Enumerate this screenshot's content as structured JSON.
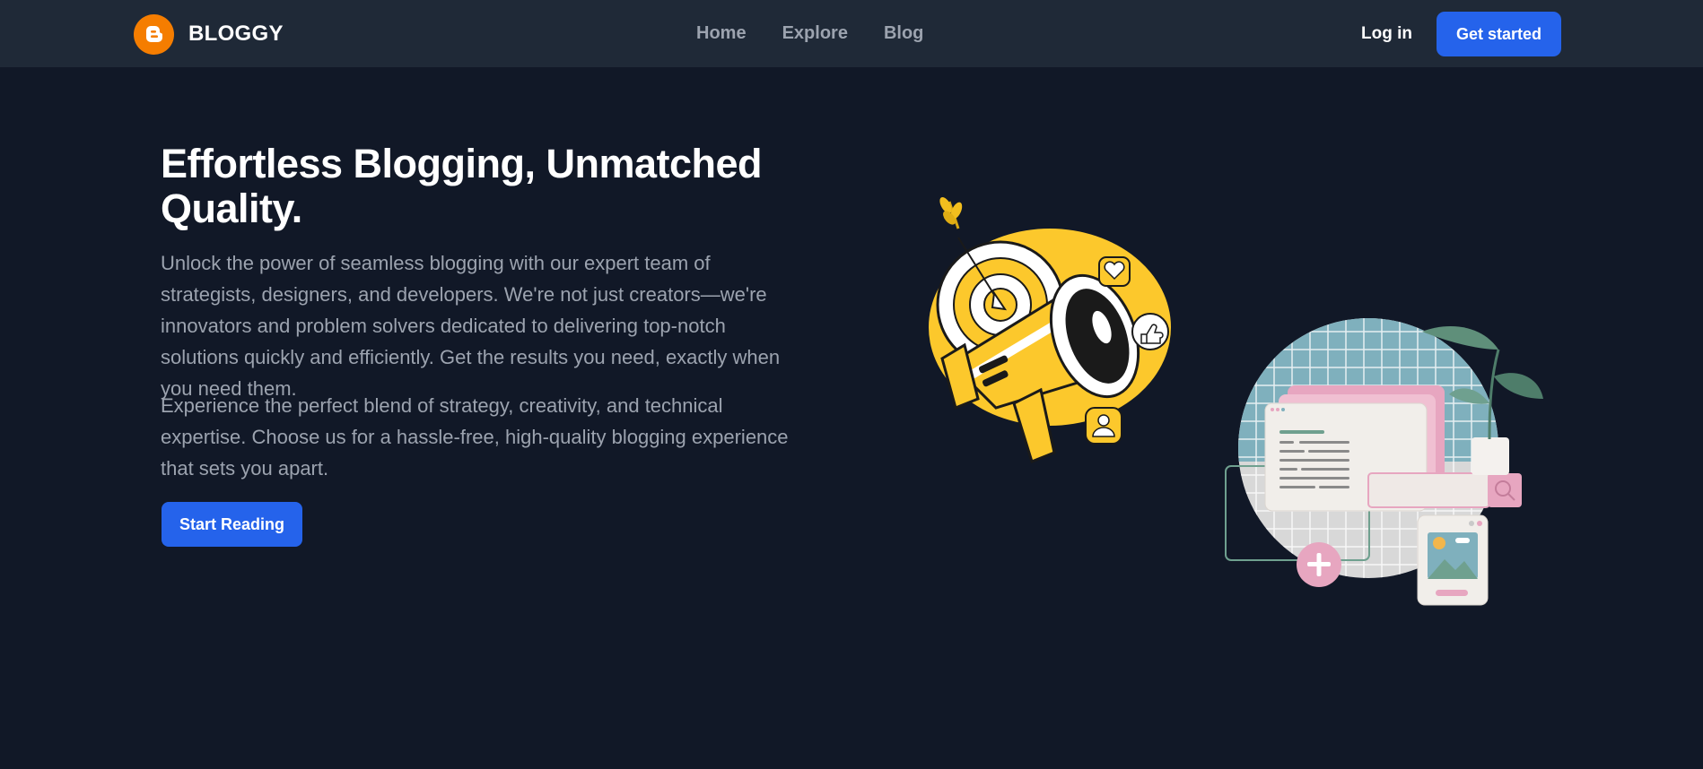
{
  "brand": {
    "name": "BLOGGY",
    "logo_icon": "blogger-b-icon",
    "logo_color": "#f57d00"
  },
  "nav": {
    "links": [
      "Home",
      "Explore",
      "Blog"
    ]
  },
  "header": {
    "login_label": "Log in",
    "cta_label": "Get started"
  },
  "hero": {
    "title": "Effortless Blogging, Unmatched Quality.",
    "paragraph1": "Unlock the power of seamless blogging with our expert team of strategists, designers, and developers. We're not just creators—we're innovators and problem solvers dedicated to delivering top-notch solutions quickly and efficiently. Get the results you need, exactly when you need them.",
    "paragraph2": "Experience the perfect blend of strategy, creativity, and technical expertise. Choose us for a hassle-free, high-quality blogging experience that sets you apart.",
    "button_label": "Start Reading"
  },
  "illustrations": {
    "left": "megaphone-target-illustration",
    "right": "blog-window-plant-illustration"
  },
  "colors": {
    "background": "#111827",
    "navbar": "#1f2937",
    "accent": "#2563eb",
    "muted_text": "#9ca3af",
    "yellow": "#fcc82c",
    "pink": "#e7a6c0",
    "teal": "#7fb0bd"
  }
}
